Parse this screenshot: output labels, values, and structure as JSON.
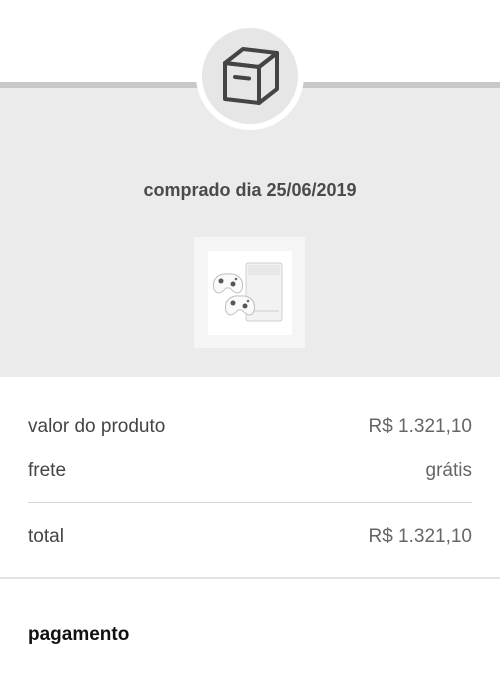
{
  "order": {
    "purchased_label": "comprado dia 25/06/2019",
    "box_icon": "package-box-icon",
    "product_image": "xbox-one-s-console-with-controllers"
  },
  "summary": {
    "product_value_label": "valor do produto",
    "product_value": "R$ 1.321,10",
    "shipping_label": "frete",
    "shipping_value": "grátis",
    "total_label": "total",
    "total_value": "R$ 1.321,10"
  },
  "payment": {
    "title": "pagamento"
  },
  "colors": {
    "panel_background": "#ebebeb",
    "panel_border": "#c8c8c8",
    "text_dark": "#333333"
  }
}
